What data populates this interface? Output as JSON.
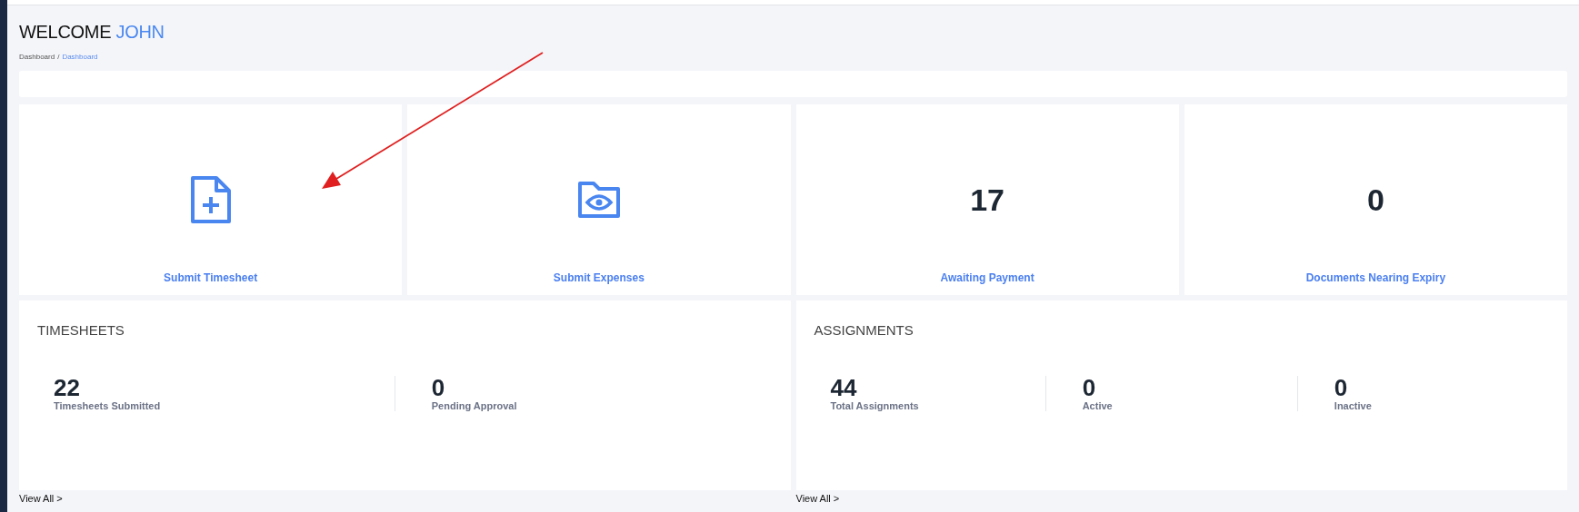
{
  "header": {
    "greeting": "WELCOME",
    "name": "JOHN"
  },
  "breadcrumb": [
    {
      "label": "Dashboard",
      "selected": false
    },
    {
      "label": "Dashboard",
      "selected": true
    }
  ],
  "breadcrumb_separator": "/",
  "tiles": [
    {
      "kind": "icon",
      "label": "Submit Timesheet"
    },
    {
      "kind": "icon",
      "label": "Submit Expenses"
    },
    {
      "kind": "count",
      "value": "17",
      "label": "Awaiting Payment"
    },
    {
      "kind": "count",
      "value": "0",
      "label": "Documents Nearing Expiry"
    }
  ],
  "panels": [
    {
      "title": "TIMESHEETS",
      "stats": [
        {
          "value": "22",
          "label": "Timesheets Submitted"
        },
        {
          "value": "0",
          "label": "Pending Approval"
        }
      ],
      "link": "View All >"
    },
    {
      "title": "ASSIGNMENTS",
      "stats": [
        {
          "value": "44",
          "label": "Total Assignments"
        },
        {
          "value": "0",
          "label": "Active"
        },
        {
          "value": "0",
          "label": "Inactive"
        }
      ],
      "link": "View All >"
    }
  ]
}
